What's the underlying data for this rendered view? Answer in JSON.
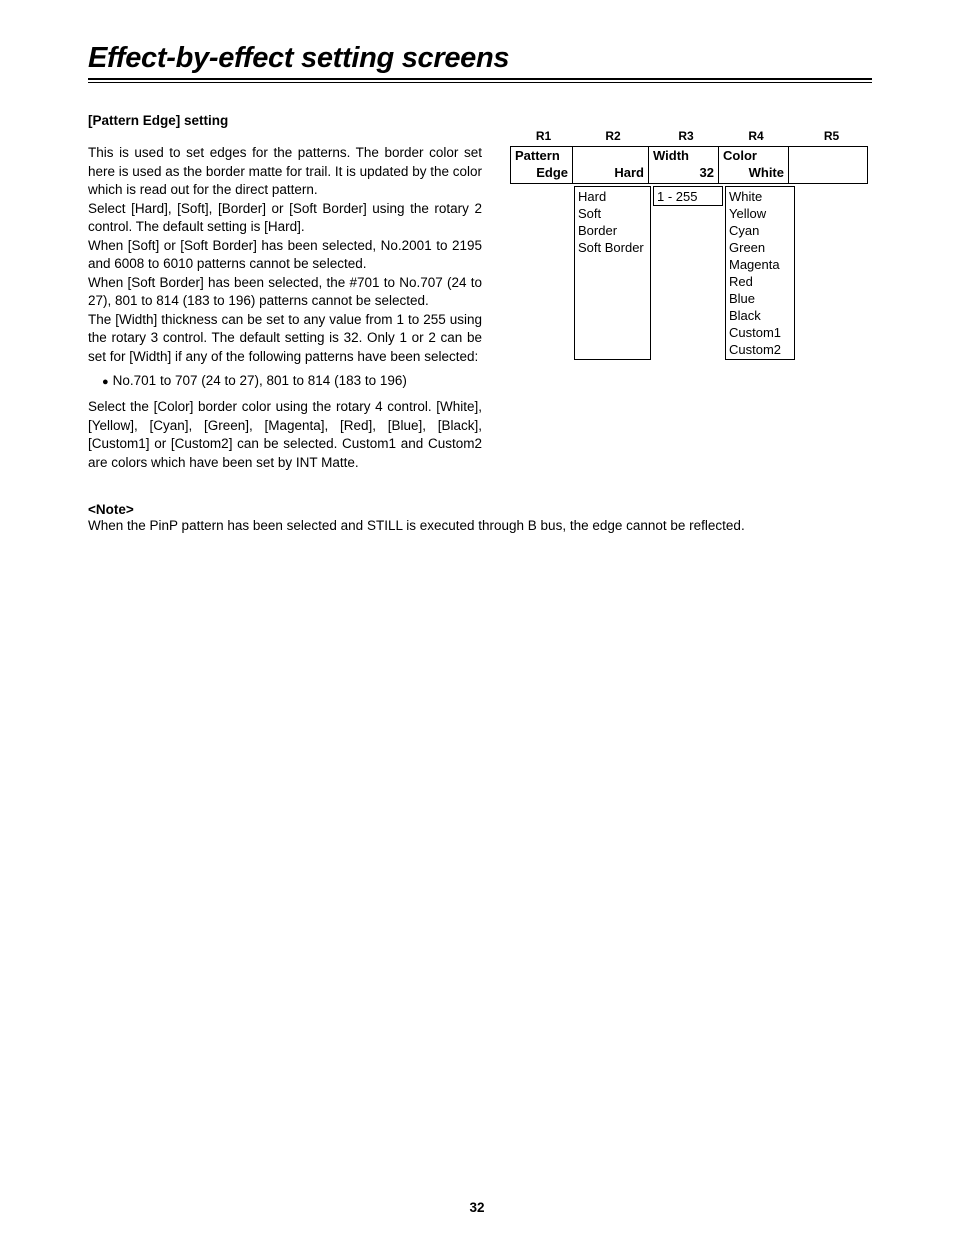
{
  "title": "Effect-by-effect setting screens",
  "section_heading": "[Pattern Edge] setting",
  "para1": "This is used to set edges for the patterns.  The border color set here is used as the border matte for trail.  It is updated by the color which is read out for the direct pattern.",
  "para2": "Select [Hard], [Soft], [Border] or [Soft Border] using the rotary 2 control.  The default setting is [Hard].",
  "para3": "When [Soft] or [Soft Border] has been selected, No.2001 to 2195 and 6008 to 6010 patterns cannot be selected.",
  "para4": "When [Soft Border] has been selected, the #701 to No.707 (24 to 27), 801 to 814 (183 to 196) patterns cannot be selected.",
  "para5": "The [Width] thickness can be set to any value from 1 to 255 using the rotary 3 control.  The default setting is 32.  Only 1 or 2 can be set for [Width] if any of the following patterns have been selected:",
  "bullet": "No.701 to 707 (24 to 27), 801 to 814 (183 to 196)",
  "para6": "Select the [Color] border color using the rotary 4 control. [White], [Yellow], [Cyan], [Green], [Magenta], [Red], [Blue], [Black], [Custom1] or [Custom2] can be selected.  Custom1 and Custom2 are colors which have been set by INT Matte.",
  "note_heading": "<Note>",
  "note_body": "When the PinP pattern has been selected and STILL is executed through B bus, the edge cannot be reflected.",
  "r_headers": {
    "r1": "R1",
    "r2": "R2",
    "r3": "R3",
    "r4": "R4",
    "r5": "R5"
  },
  "table": {
    "col1_l1": "Pattern",
    "col1_l2": "Edge",
    "col2_value": "Hard",
    "col3_label": "Width",
    "col3_value": "32",
    "col4_label": "Color",
    "col4_value": "White"
  },
  "options_r2": [
    "Hard",
    "Soft",
    "Border",
    "Soft Border"
  ],
  "options_r3": "1 - 255",
  "options_r4": [
    "White",
    "Yellow",
    "Cyan",
    "Green",
    "Magenta",
    "Red",
    "Blue",
    "Black",
    "Custom1",
    "Custom2"
  ],
  "page_number": "32"
}
